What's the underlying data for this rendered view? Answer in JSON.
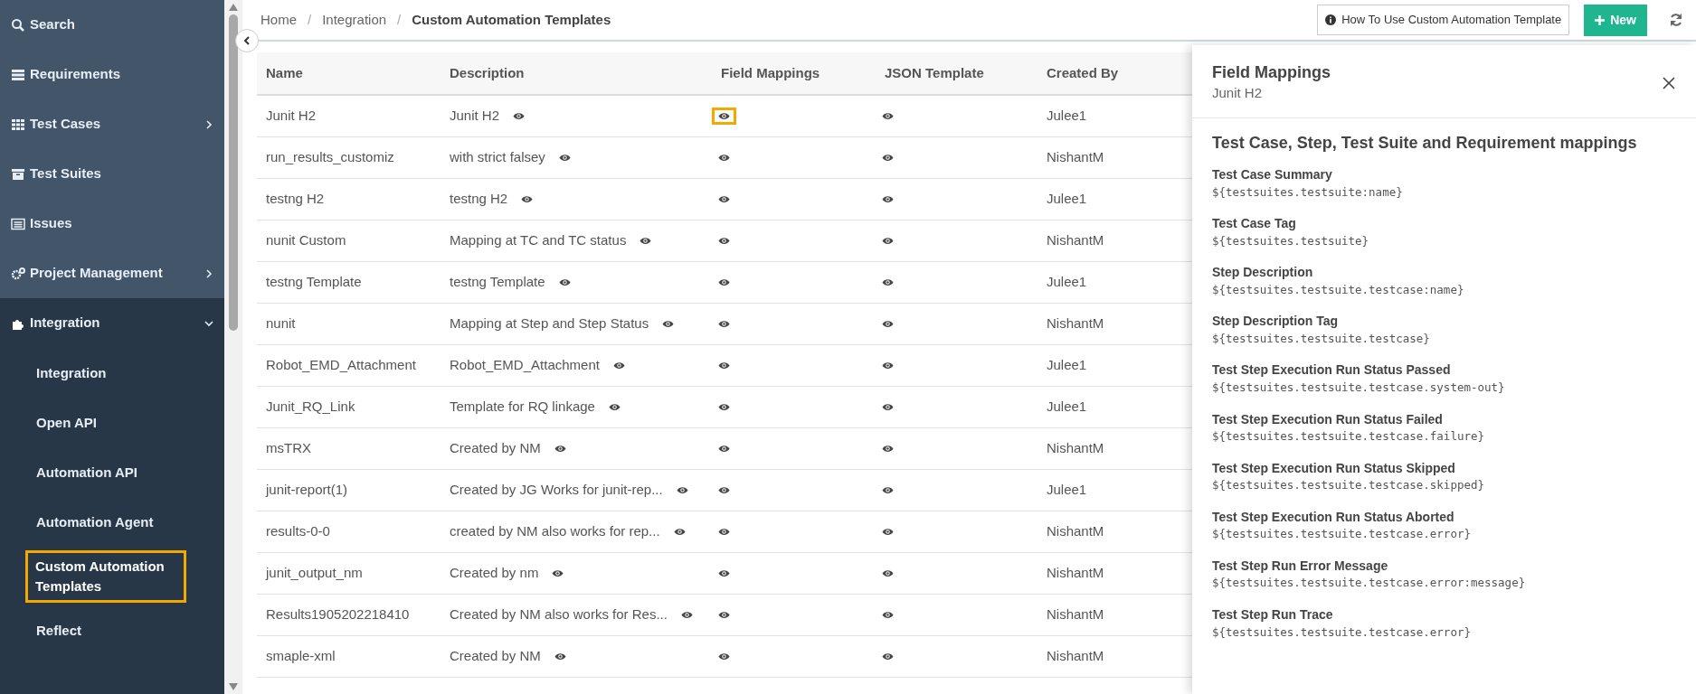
{
  "sidebar": {
    "items": [
      {
        "label": "Search",
        "kind": "link"
      },
      {
        "label": "Requirements",
        "kind": "link"
      },
      {
        "label": "Test Cases",
        "kind": "group",
        "expanded": false
      },
      {
        "label": "Test Suites",
        "kind": "link"
      },
      {
        "label": "Issues",
        "kind": "link"
      },
      {
        "label": "Project Management",
        "kind": "group",
        "expanded": false
      },
      {
        "label": "Integration",
        "kind": "group",
        "expanded": true,
        "children": [
          {
            "label": "Integration",
            "selected": false
          },
          {
            "label": "Open API",
            "selected": false
          },
          {
            "label": "Automation API",
            "selected": false
          },
          {
            "label": "Automation Agent",
            "selected": false
          },
          {
            "label": "Custom Automation Templates",
            "selected": true
          },
          {
            "label": "Reflect",
            "selected": false
          }
        ]
      }
    ]
  },
  "breadcrumb": {
    "separator": "/",
    "items": [
      {
        "label": "Home",
        "current": false
      },
      {
        "label": "Integration",
        "current": false
      },
      {
        "label": "Custom Automation Templates",
        "current": true
      }
    ]
  },
  "toolbar": {
    "help_button": "How To Use Custom Automation Template",
    "new_button": "New"
  },
  "table": {
    "columns": [
      "Name",
      "Description",
      "Field Mappings",
      "JSON Template",
      "Created By"
    ],
    "rows": [
      {
        "name": "Junit H2",
        "description": "Junit H2",
        "created_by": "Julee1",
        "field_mappings_highlighted": true
      },
      {
        "name": "run_results_customiz",
        "description": "with strict falsey",
        "created_by": "NishantM",
        "field_mappings_highlighted": false
      },
      {
        "name": "testng H2",
        "description": "testng H2",
        "created_by": "Julee1",
        "field_mappings_highlighted": false
      },
      {
        "name": "nunit Custom",
        "description": "Mapping at TC and TC status",
        "created_by": "NishantM",
        "field_mappings_highlighted": false
      },
      {
        "name": "testng Template",
        "description": "testng Template",
        "created_by": "Julee1",
        "field_mappings_highlighted": false
      },
      {
        "name": "nunit",
        "description": "Mapping at Step and Step Status",
        "created_by": "NishantM",
        "field_mappings_highlighted": false
      },
      {
        "name": "Robot_EMD_Attachment",
        "description": "Robot_EMD_Attachment",
        "created_by": "Julee1",
        "field_mappings_highlighted": false
      },
      {
        "name": "Junit_RQ_Link",
        "description": "Template for RQ linkage",
        "created_by": "Julee1",
        "field_mappings_highlighted": false
      },
      {
        "name": "msTRX",
        "description": "Created by NM",
        "created_by": "NishantM",
        "field_mappings_highlighted": false
      },
      {
        "name": "junit-report(1)",
        "description": "Created by JG Works for junit-rep...",
        "created_by": "Julee1",
        "field_mappings_highlighted": false
      },
      {
        "name": "results-0-0",
        "description": "created by NM also works for rep...",
        "created_by": "NishantM",
        "field_mappings_highlighted": false
      },
      {
        "name": "junit_output_nm",
        "description": "Created by nm",
        "created_by": "NishantM",
        "field_mappings_highlighted": false
      },
      {
        "name": "Results1905202218410",
        "description": "Created by NM also works for Res...",
        "created_by": "NishantM",
        "field_mappings_highlighted": false
      },
      {
        "name": "smaple-xml",
        "description": "Created by NM",
        "created_by": "NishantM",
        "field_mappings_highlighted": false
      }
    ]
  },
  "panel": {
    "title": "Field Mappings",
    "subtitle": "Junit H2",
    "section_title": "Test Case, Step, Test Suite and Requirement mappings",
    "mappings": [
      {
        "label": "Test Case Summary",
        "value": "${testsuites.testsuite:name}"
      },
      {
        "label": "Test Case Tag",
        "value": "${testsuites.testsuite}"
      },
      {
        "label": "Step Description",
        "value": "${testsuites.testsuite.testcase:name}"
      },
      {
        "label": "Step Description Tag",
        "value": "${testsuites.testsuite.testcase}"
      },
      {
        "label": "Test Step Execution Run Status Passed",
        "value": "${testsuites.testsuite.testcase.system-out}"
      },
      {
        "label": "Test Step Execution Run Status Failed",
        "value": "${testsuites.testsuite.testcase.failure}"
      },
      {
        "label": "Test Step Execution Run Status Skipped",
        "value": "${testsuites.testsuite.testcase.skipped}"
      },
      {
        "label": "Test Step Execution Run Status Aborted",
        "value": "${testsuites.testsuite.testcase.error}"
      },
      {
        "label": "Test Step Run Error Message",
        "value": "${testsuites.testsuite.testcase.error:message}"
      },
      {
        "label": "Test Step Run Trace",
        "value": "${testsuites.testsuite.testcase.error}"
      }
    ]
  }
}
